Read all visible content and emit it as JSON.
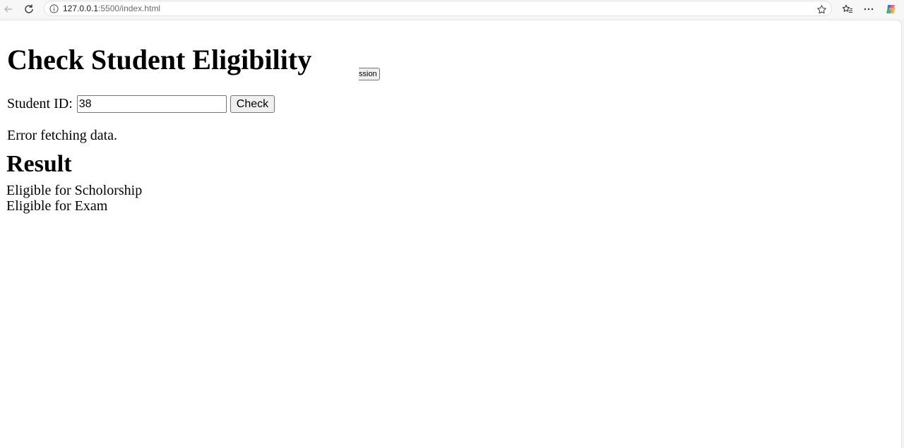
{
  "browser": {
    "url_host": "127.0.0.1",
    "url_path": ":5500/index.html",
    "icons": {
      "back": "back-arrow-icon",
      "refresh": "refresh-icon",
      "info": "info-icon",
      "favorite": "star-icon",
      "favorites": "favorites-icon",
      "more": "more-icon",
      "copilot": "copilot-icon"
    }
  },
  "page": {
    "title": "Check Student Eligibility",
    "floating_button_label": "ssion",
    "form": {
      "label": "Student ID:",
      "input_value": "38",
      "check_label": "Check"
    },
    "error_message": "Error fetching data.",
    "result": {
      "heading": "Result",
      "items": [
        "Eligible for Scholorship",
        "Eligible for Exam"
      ]
    }
  }
}
